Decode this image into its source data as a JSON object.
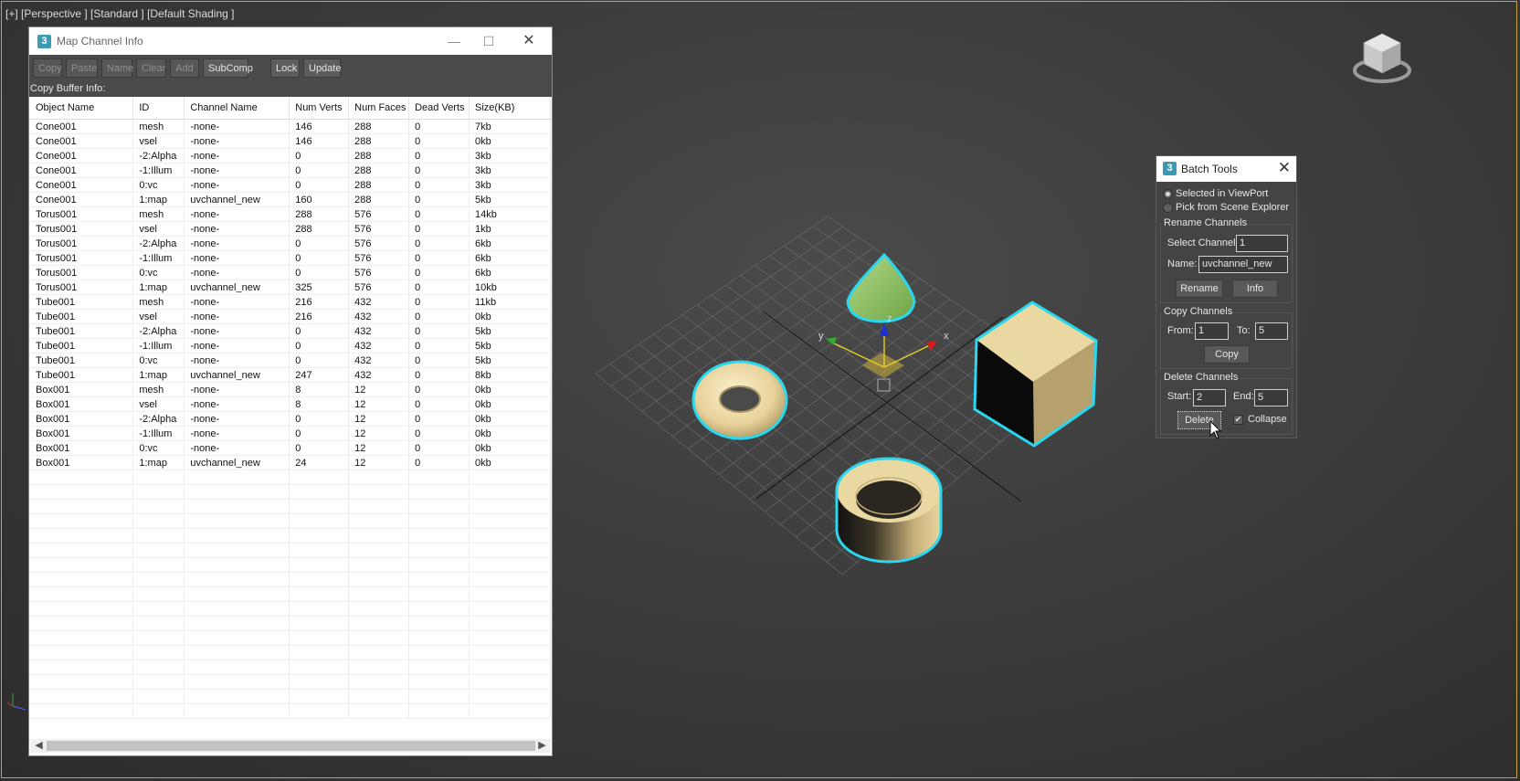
{
  "viewport": {
    "label": "[+] [Perspective ] [Standard ] [Default Shading ]"
  },
  "map_channel_info": {
    "title": "Map Channel Info",
    "window_controls": {
      "minimize": "—",
      "maximize": "☐",
      "close": "✕"
    },
    "toolbar": {
      "copy": "Copy",
      "paste": "Paste",
      "name": "Name",
      "clear": "Clear",
      "add": "Add",
      "subcomp": "SubComp",
      "lock": "Lock",
      "update": "Update"
    },
    "copy_buffer_label": "Copy Buffer Info:",
    "columns": [
      "Object Name",
      "ID",
      "Channel Name",
      "Num Verts",
      "Num Faces",
      "Dead Verts",
      "Size(KB)"
    ],
    "rows": [
      [
        "Cone001",
        "mesh",
        "-none-",
        "146",
        "288",
        "0",
        "7kb"
      ],
      [
        "Cone001",
        "vsel",
        "-none-",
        "146",
        "288",
        "0",
        "0kb"
      ],
      [
        "Cone001",
        "-2:Alpha",
        "-none-",
        "0",
        "288",
        "0",
        "3kb"
      ],
      [
        "Cone001",
        "-1:Illum",
        "-none-",
        "0",
        "288",
        "0",
        "3kb"
      ],
      [
        "Cone001",
        "0:vc",
        "-none-",
        "0",
        "288",
        "0",
        "3kb"
      ],
      [
        "Cone001",
        "1:map",
        "uvchannel_new",
        "160",
        "288",
        "0",
        "5kb"
      ],
      [
        "Torus001",
        "mesh",
        "-none-",
        "288",
        "576",
        "0",
        "14kb"
      ],
      [
        "Torus001",
        "vsel",
        "-none-",
        "288",
        "576",
        "0",
        "1kb"
      ],
      [
        "Torus001",
        "-2:Alpha",
        "-none-",
        "0",
        "576",
        "0",
        "6kb"
      ],
      [
        "Torus001",
        "-1:Illum",
        "-none-",
        "0",
        "576",
        "0",
        "6kb"
      ],
      [
        "Torus001",
        "0:vc",
        "-none-",
        "0",
        "576",
        "0",
        "6kb"
      ],
      [
        "Torus001",
        "1:map",
        "uvchannel_new",
        "325",
        "576",
        "0",
        "10kb"
      ],
      [
        "Tube001",
        "mesh",
        "-none-",
        "216",
        "432",
        "0",
        "11kb"
      ],
      [
        "Tube001",
        "vsel",
        "-none-",
        "216",
        "432",
        "0",
        "0kb"
      ],
      [
        "Tube001",
        "-2:Alpha",
        "-none-",
        "0",
        "432",
        "0",
        "5kb"
      ],
      [
        "Tube001",
        "-1:Illum",
        "-none-",
        "0",
        "432",
        "0",
        "5kb"
      ],
      [
        "Tube001",
        "0:vc",
        "-none-",
        "0",
        "432",
        "0",
        "5kb"
      ],
      [
        "Tube001",
        "1:map",
        "uvchannel_new",
        "247",
        "432",
        "0",
        "8kb"
      ],
      [
        "Box001",
        "mesh",
        "-none-",
        "8",
        "12",
        "0",
        "0kb"
      ],
      [
        "Box001",
        "vsel",
        "-none-",
        "8",
        "12",
        "0",
        "0kb"
      ],
      [
        "Box001",
        "-2:Alpha",
        "-none-",
        "0",
        "12",
        "0",
        "0kb"
      ],
      [
        "Box001",
        "-1:Illum",
        "-none-",
        "0",
        "12",
        "0",
        "0kb"
      ],
      [
        "Box001",
        "0:vc",
        "-none-",
        "0",
        "12",
        "0",
        "0kb"
      ],
      [
        "Box001",
        "1:map",
        "uvchannel_new",
        "24",
        "12",
        "0",
        "0kb"
      ]
    ]
  },
  "batch_tools": {
    "title": "Batch Tools",
    "close": "✕",
    "selection": {
      "selected_in_viewport": "Selected in ViewPort",
      "pick_from_explorer": "Pick from Scene Explorer",
      "selected": "viewport"
    },
    "rename": {
      "group_title": "Rename Channels",
      "select_channel_label": "Select Channel:",
      "select_channel_value": "1",
      "name_label": "Name:",
      "name_value": "uvchannel_new",
      "rename_button": "Rename",
      "info_button": "Info"
    },
    "copy": {
      "group_title": "Copy Channels",
      "from_label": "From:",
      "from_value": "1",
      "to_label": "To:",
      "to_value": "5",
      "copy_button": "Copy"
    },
    "delete": {
      "group_title": "Delete Channels",
      "start_label": "Start:",
      "start_value": "2",
      "end_label": "End:",
      "end_value": "5",
      "delete_button": "Delete",
      "collapse_label": "Collapse",
      "collapse_checked": true
    }
  },
  "gizmo_axes": {
    "x": "x",
    "y": "y",
    "z": "z"
  },
  "colors": {
    "selection_outline": "#29d8f0",
    "object_fill": "#ead8a2",
    "cone_fill": "#8fc060",
    "viewport_border": "#c8a34a"
  },
  "icons": {
    "app": "3ds-max-icon",
    "navcube": "viewcube-icon",
    "cursor": "mouse-pointer-icon"
  }
}
